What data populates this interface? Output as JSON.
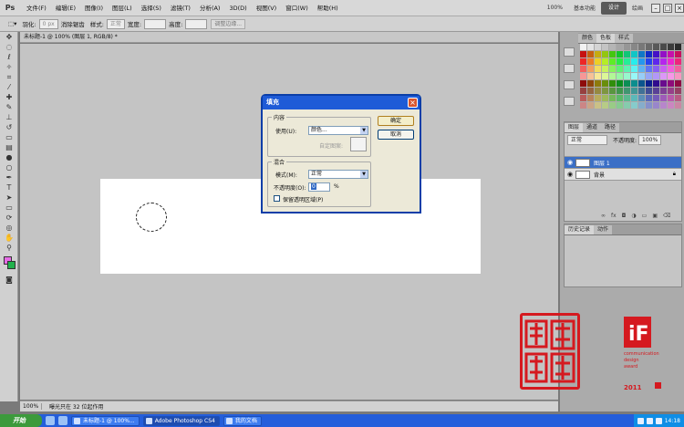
{
  "menubar": {
    "logo": "Ps",
    "items": [
      "文件(F)",
      "编辑(E)",
      "图像(I)",
      "图层(L)",
      "选择(S)",
      "滤镜(T)",
      "分析(A)",
      "3D(D)",
      "视图(V)",
      "窗口(W)",
      "帮助(H)"
    ],
    "zoom": "100%",
    "workspaces": [
      "基本功能",
      "设计",
      "绘画"
    ]
  },
  "options": {
    "feather_label": "羽化:",
    "feather_value": "0 px",
    "antialias": "消除锯齿",
    "style_label": "样式:",
    "style_value": "正常",
    "width_label": "宽度:",
    "height_label": "高度:",
    "refine_edge": "调整边缘..."
  },
  "document": {
    "tab_title": "未标题-1 @ 100% (图层 1, RGB/8) *"
  },
  "status": {
    "zoom": "100%",
    "info": "曝光只在 32 位起作用"
  },
  "panels": {
    "color_tabs": [
      "颜色",
      "色板",
      "样式"
    ],
    "layer_tabs": [
      "图层",
      "通道",
      "路径"
    ],
    "blend_mode": "正常",
    "opacity_label": "不透明度:",
    "opacity_value": "100%",
    "layers": [
      {
        "name": "图层 1",
        "selected": true
      },
      {
        "name": "背景",
        "selected": false
      }
    ],
    "history_tabs": [
      "历史记录",
      "动作"
    ]
  },
  "dialog": {
    "title": "填充",
    "ok": "确定",
    "cancel": "取消",
    "contents_group": "内容",
    "use_label": "使用(U):",
    "use_value": "颜色...",
    "custom_pattern_label": "自定图案:",
    "blending_group": "混合",
    "mode_label": "模式(M):",
    "mode_value": "正常",
    "opacity_label": "不透明度(O):",
    "opacity_value": "0",
    "opacity_unit": "%",
    "preserve_label": "保留透明区域(P)"
  },
  "taskbar": {
    "start": "开始",
    "tasks": [
      "未标题-1 @ 100%...",
      "Adobe Photoshop CS4",
      "我的文档"
    ],
    "clock": "14:18"
  },
  "branding": {
    "seal_text": [
      "创",
      "意",
      "无",
      "限"
    ],
    "award_lines": [
      "communication",
      "design",
      "award"
    ],
    "award_year": "2011"
  },
  "colors": {
    "dialog_title": "#1e5bd7",
    "taskbar": "#245edb",
    "seal_red": "#d5191f",
    "layer_selected": "#3b6fc6"
  }
}
